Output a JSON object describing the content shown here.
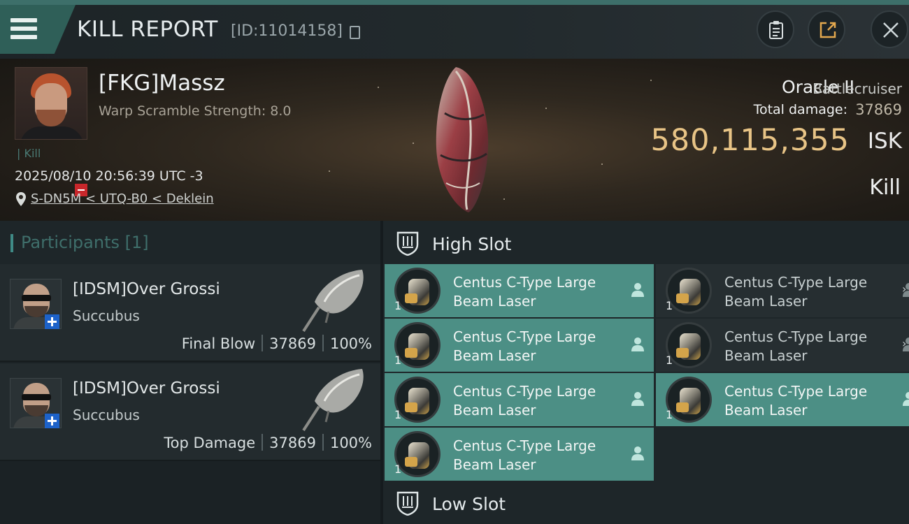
{
  "header": {
    "title": "KILL REPORT",
    "report_id": "[ID:11014158]",
    "icons": [
      "menu-icon",
      "copy-icon",
      "notes-icon",
      "share-icon",
      "close-icon"
    ]
  },
  "victim": {
    "name": "[FKG]Massz",
    "stat": "Warp Scramble Strength: 8.0",
    "tag": "Kill",
    "datetime": "2025/08/10 20:56:39 UTC -3",
    "location": "S-DN5M < UTQ-B0 < Deklein",
    "ship_name": "Oracle II",
    "ship_class": "Battlecruiser",
    "damage_label": "Total damage:",
    "damage_value": "37869",
    "isk_value": "580,115,355",
    "isk_unit": "ISK",
    "result": "Kill"
  },
  "participants": {
    "title": "Participants [1]",
    "rows": [
      {
        "name": "[IDSM]Over Grossi",
        "ship": "Succubus",
        "role": "Final Blow",
        "damage": "37869",
        "percent": "100%"
      },
      {
        "name": "[IDSM]Over Grossi",
        "ship": "Succubus",
        "role": "Top Damage",
        "damage": "37869",
        "percent": "100%"
      }
    ]
  },
  "fittings": {
    "high_slot_title": "High Slot",
    "low_slot_title": "Low Slot",
    "modules": [
      {
        "line1": "Centus C-Type Large",
        "line2": "Beam Laser",
        "qty": "1",
        "state": "fitted"
      },
      {
        "line1": "Centus C-Type Large",
        "line2": "Beam Laser",
        "qty": "1",
        "state": "plain"
      },
      {
        "line1": "Centus C-Type Large",
        "line2": "Beam Laser",
        "qty": "1",
        "state": "fitted"
      },
      {
        "line1": "Centus C-Type Large",
        "line2": "Beam Laser",
        "qty": "1",
        "state": "plain"
      },
      {
        "line1": "Centus C-Type Large",
        "line2": "Beam Laser",
        "qty": "1",
        "state": "fitted"
      },
      {
        "line1": "Centus C-Type Large",
        "line2": "Beam Laser",
        "qty": "1",
        "state": "fitted"
      },
      {
        "line1": "Centus C-Type Large",
        "line2": "Beam Laser",
        "qty": "1",
        "state": "fitted"
      }
    ]
  },
  "colors": {
    "accent": "#4c8f85",
    "isk": "#e8c486",
    "minus_badge": "#c8272b",
    "plus_badge": "#1d62c9"
  }
}
